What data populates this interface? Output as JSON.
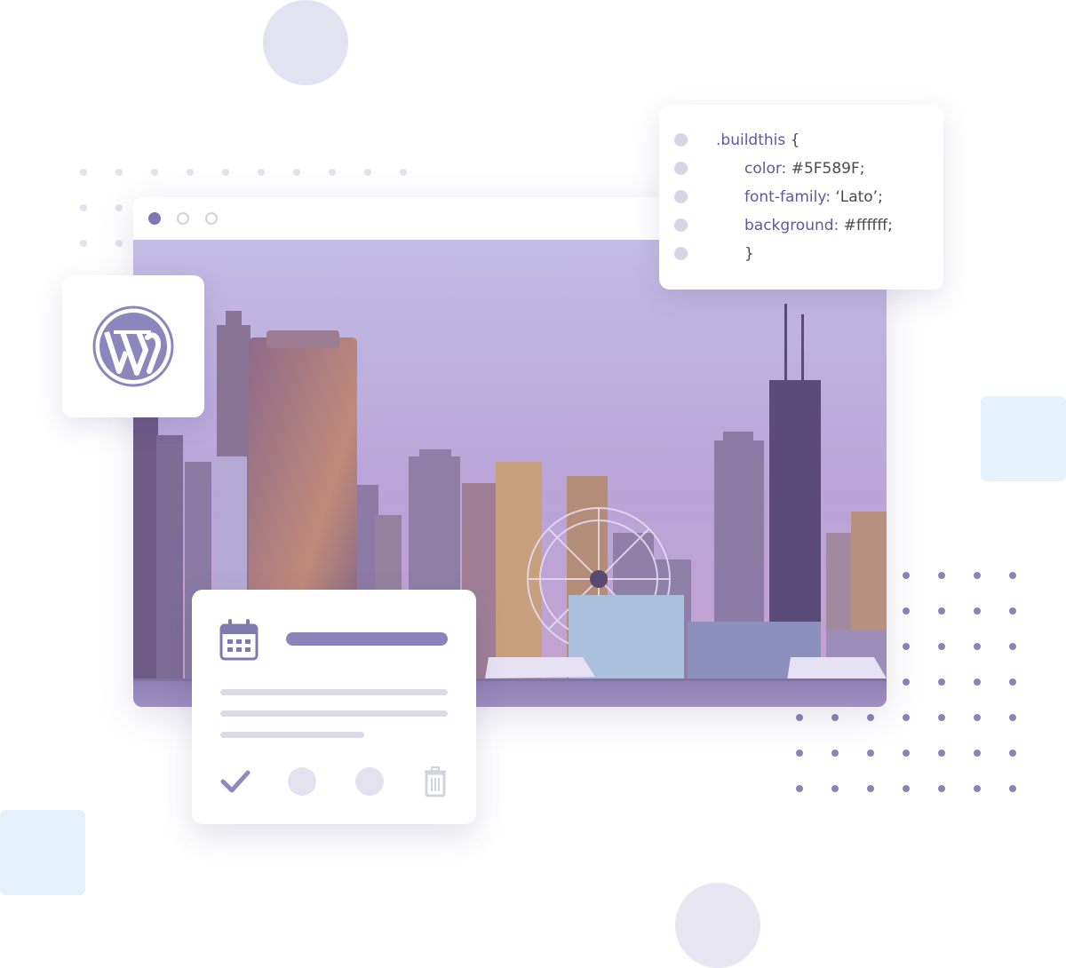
{
  "code_card": {
    "lines": [
      {
        "selector": ".buildthis",
        "brace": "{"
      },
      {
        "property": "color:",
        "value": "#5F589F;"
      },
      {
        "property": "font-family:",
        "value": "‘Lato’;"
      },
      {
        "property": "background:",
        "value": "#ffffff;"
      },
      {
        "brace": "}"
      }
    ]
  },
  "wordpress_card": {
    "icon": "wordpress-logo-icon"
  },
  "browser": {
    "window_controls": [
      "active-dot-icon",
      "dot-icon",
      "dot-icon"
    ],
    "image": "city-skyline-image"
  },
  "event_card": {
    "icon": "calendar-icon",
    "actions": [
      "check-icon",
      "circle-icon",
      "circle-icon",
      "trash-icon"
    ]
  },
  "colors": {
    "brand": "#5F589F",
    "accent_light": "#E3E2F0",
    "aqua_light": "#E4F3F9"
  }
}
